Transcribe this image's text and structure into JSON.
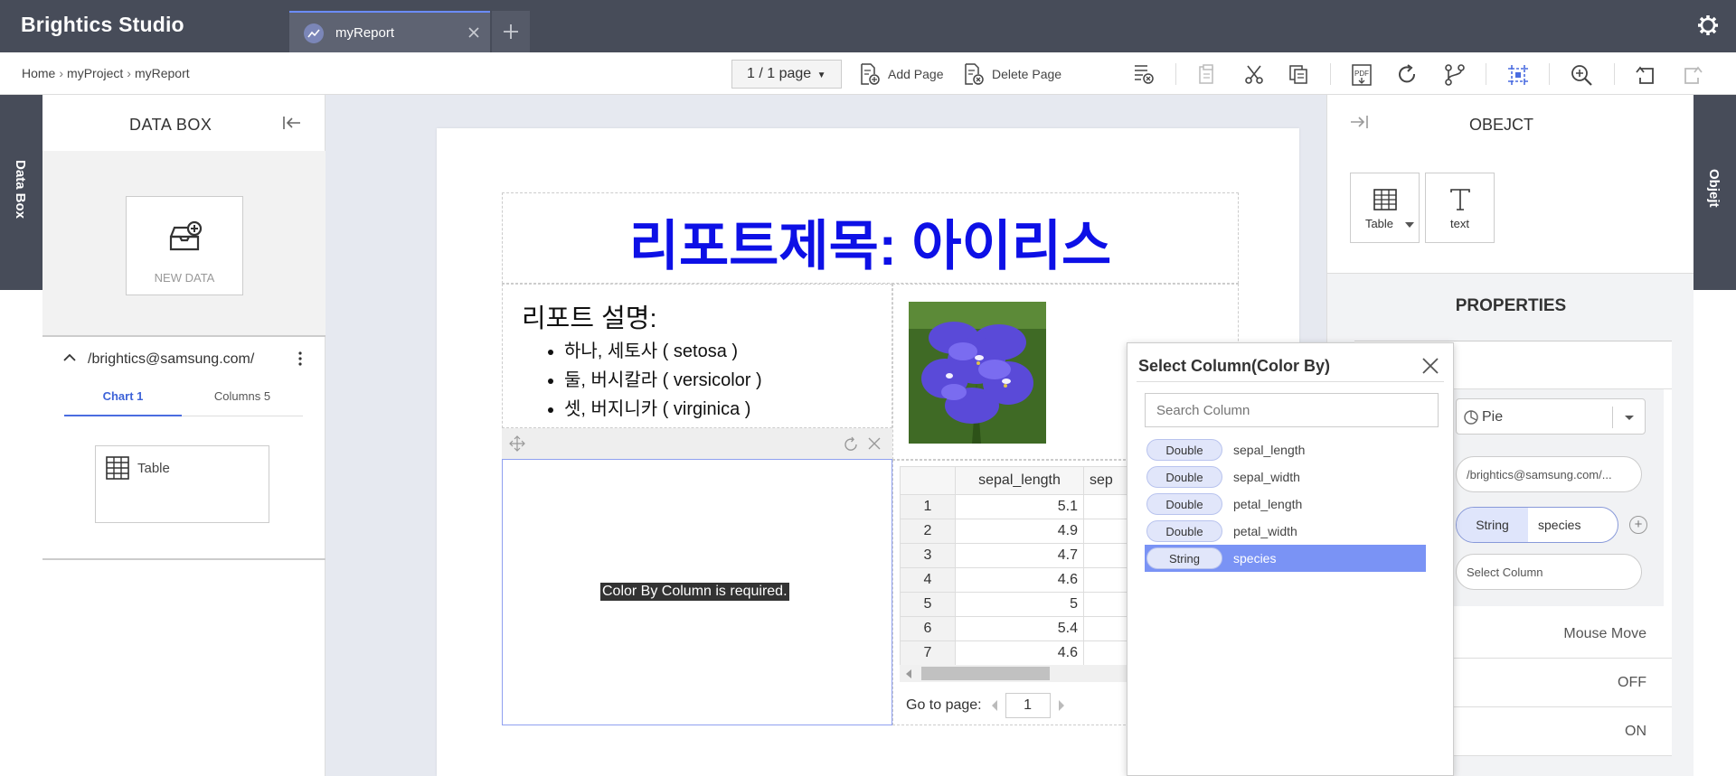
{
  "app": {
    "title": "Brightics Studio"
  },
  "tabs": [
    {
      "label": "myReport"
    }
  ],
  "breadcrumb": [
    "Home",
    "myProject",
    "myReport"
  ],
  "toolbar": {
    "page_indicator": "1 / 1 page",
    "add_page": "Add Page",
    "delete_page": "Delete Page"
  },
  "left_side_tab": "Data Box",
  "right_side_tab": "Objejt",
  "databox": {
    "title": "DATA BOX",
    "new_data": "NEW DATA",
    "source": "/brightics@samsung.com/",
    "tabs": [
      "Chart 1",
      "Columns 5"
    ],
    "items": [
      {
        "label": "Table"
      }
    ]
  },
  "report": {
    "title": "리포트제목: 아이리스",
    "description_heading": "리포트 설명:",
    "description_items": [
      "하나, 세토사 ( setosa )",
      "둘, 버시칼라 ( versicolor )",
      "셋, 버지니카 ( virginica )"
    ],
    "chart_message": "Color By Column is required."
  },
  "grid": {
    "columns": [
      "sepal_length",
      "sep"
    ],
    "rows": [
      {
        "n": "1",
        "v": "5.1"
      },
      {
        "n": "2",
        "v": "4.9"
      },
      {
        "n": "3",
        "v": "4.7"
      },
      {
        "n": "4",
        "v": "4.6"
      },
      {
        "n": "5",
        "v": "5"
      },
      {
        "n": "6",
        "v": "5.4"
      },
      {
        "n": "7",
        "v": "4.6"
      }
    ],
    "goto_label": "Go to page:",
    "page": "1"
  },
  "object_panel": {
    "title": "OBEJCT",
    "objects": [
      {
        "label": "Table"
      },
      {
        "label": "text"
      }
    ],
    "properties_title": "PROPERTIES",
    "chart_type": "Pie",
    "source_path": "/brightics@samsung.com/...",
    "selected_column": {
      "type": "String",
      "name": "species"
    },
    "select_column_placeholder": "Select Column",
    "rows": [
      "Mouse Move",
      "OFF",
      "ON"
    ]
  },
  "dialog": {
    "title": "Select Column(Color By)",
    "search_placeholder": "Search Column",
    "columns": [
      {
        "type": "Double",
        "name": "sepal_length"
      },
      {
        "type": "Double",
        "name": "sepal_width"
      },
      {
        "type": "Double",
        "name": "petal_length"
      },
      {
        "type": "Double",
        "name": "petal_width"
      },
      {
        "type": "String",
        "name": "species",
        "selected": true
      }
    ]
  },
  "colors": {
    "topbar": "#474c59",
    "accent": "#4a6ce0",
    "title_blue": "#0d10e6",
    "selection": "#7a93f5"
  }
}
